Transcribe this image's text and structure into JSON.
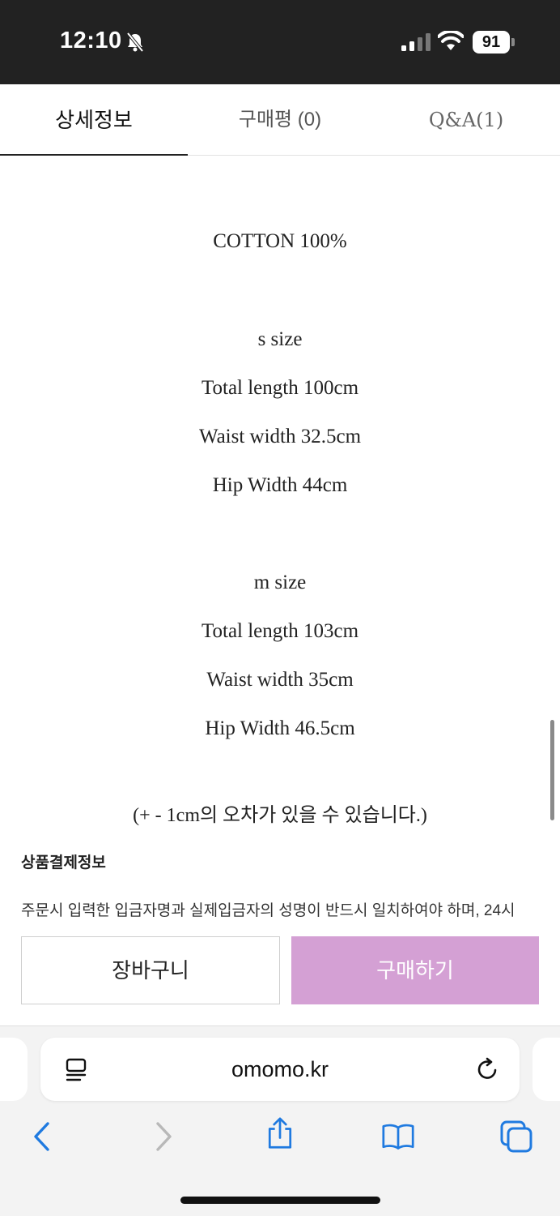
{
  "status_bar": {
    "time": "12:10",
    "battery": "91"
  },
  "tabs": [
    {
      "label": "상세정보"
    },
    {
      "label": "구매평 (0)"
    },
    {
      "label": "Q&A(1)"
    }
  ],
  "content": {
    "material": "COTTON 100%",
    "sizes": [
      {
        "name": "s size",
        "lines": [
          "Total length 100cm",
          "Waist width 32.5cm",
          "Hip Width 44cm"
        ]
      },
      {
        "name": "m size",
        "lines": [
          "Total length 103cm",
          "Waist width 35cm",
          "Hip Width 46.5cm"
        ]
      }
    ],
    "tolerance_note": "(+ - 1cm의 오차가 있을 수 있습니다.)",
    "payment_title": "상품결제정보",
    "payment_text": "주문시 입력한 입금자명과 실제입금자의 성명이 반드시 일치하여야 하며, 24시"
  },
  "actions": {
    "cart_label": "장바구니",
    "buy_label": "구매하기",
    "buy_color": "#d4a0d4"
  },
  "browser": {
    "url": "omomo.kr",
    "icons": [
      "reader-icon",
      "reload-icon",
      "back-icon",
      "forward-icon",
      "share-icon",
      "bookmarks-icon",
      "tabs-icon"
    ]
  }
}
